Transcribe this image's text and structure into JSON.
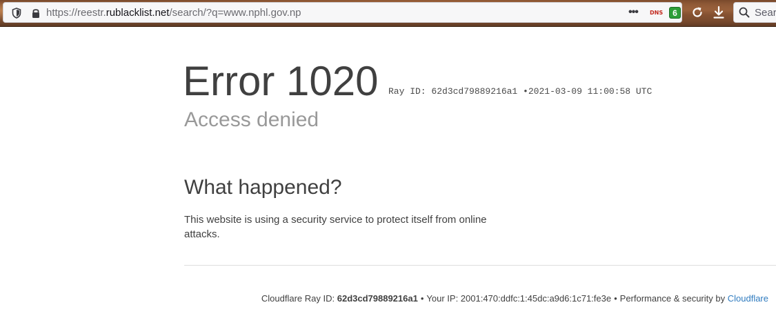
{
  "browser": {
    "url_prefix": "https://reestr.",
    "url_domain": "rublacklist.net",
    "url_suffix": "/search/?q=www.nphl.gov.np",
    "more_label": "•••",
    "dns_label": "DNS",
    "extension_badge": "6",
    "search_placeholder": "Search"
  },
  "error": {
    "title": "Error 1020",
    "ray_label": "Ray ID: 62d3cd79889216a1",
    "ray_sep": "•",
    "timestamp": "2021-03-09 11:00:58 UTC",
    "subtitle": "Access denied"
  },
  "what_happened": {
    "heading": "What happened?",
    "text": "This website is using a security service to protect itself from online attacks."
  },
  "footer": {
    "ray_prefix": "Cloudflare Ray ID:",
    "ray_id": "62d3cd79889216a1",
    "sep": "•",
    "ip_text": "Your IP: 2001:470:ddfc:1:45dc:a9d6:1c71:fe3e",
    "perf_text": "Performance & security by",
    "cloudflare_link": "Cloudflare"
  },
  "colors": {
    "link": "#2f7bbf",
    "text": "#404040",
    "subtitle": "#999999",
    "badge_green": "#2e9e38",
    "dns_red": "#c2281d"
  },
  "icons": [
    "shield-icon",
    "lock-icon",
    "more-icon",
    "reload-icon",
    "download-icon",
    "search-icon"
  ]
}
